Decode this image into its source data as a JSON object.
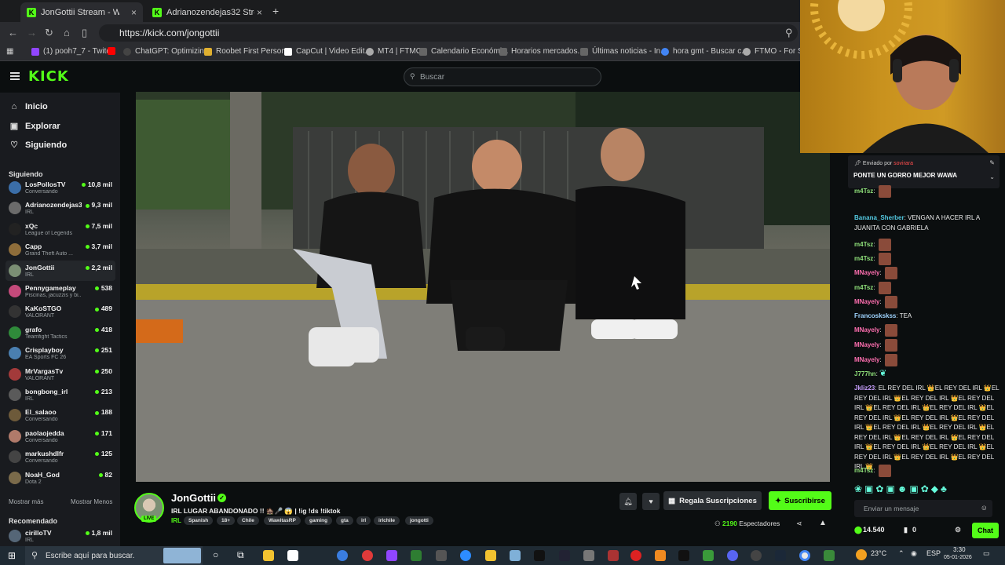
{
  "browser": {
    "tabs": [
      {
        "label": "JonGottii Stream - Watch L...",
        "active": true
      },
      {
        "label": "Adrianozendejas32 Stream - W...",
        "active": false
      }
    ],
    "new_tab": "+",
    "url": "https://kick.com/jongottii",
    "bookmarks": [
      "(1) pooh7_7 - Twitch",
      "ChatGPT: Optimizin...",
      "Roobet First Person...",
      "CapCut | Video Edit...",
      "MT4 | FTMO",
      "Calendario Económi...",
      "Horarios mercados...",
      "Últimas noticias - In...",
      "hora gmt - Buscar c...",
      "FTMO - For Serio"
    ]
  },
  "header": {
    "logo": "KICK",
    "search_placeholder": "Buscar"
  },
  "sidebar": {
    "nav": [
      "Inicio",
      "Explorar",
      "Siguiendo"
    ],
    "following_title": "Siguiendo",
    "following": [
      {
        "name": "LosPollosTV",
        "category": "Conversando",
        "viewers": "10,8 mil",
        "color": "#3b6ea8"
      },
      {
        "name": "Adrianozendejas32",
        "category": "IRL",
        "viewers": "9,3 mil",
        "color": "#6b6b6b"
      },
      {
        "name": "xQc",
        "category": "League of Legends",
        "viewers": "7,5 mil",
        "color": "#222222"
      },
      {
        "name": "Capp",
        "category": "Grand Theft Auto ...",
        "viewers": "3,7 mil",
        "color": "#8e6d3a"
      },
      {
        "name": "JonGottii",
        "category": "IRL",
        "viewers": "2,2 mil",
        "color": "#7b8f74"
      },
      {
        "name": "Pennygameplay",
        "category": "Piscinas, jacuzzis y bi...",
        "viewers": "538",
        "color": "#c44a7b"
      },
      {
        "name": "KaKoSTGO",
        "category": "VALORANT",
        "viewers": "489",
        "color": "#333333"
      },
      {
        "name": "grafo",
        "category": "Teamfight Tactics",
        "viewers": "418",
        "color": "#2f8a3a"
      },
      {
        "name": "Crisplayboy",
        "category": "EA Sports FC 26",
        "viewers": "251",
        "color": "#4a7fb0"
      },
      {
        "name": "MrVargasTv",
        "category": "VALORANT",
        "viewers": "250",
        "color": "#a33a3a"
      },
      {
        "name": "bongbong_irl",
        "category": "IRL",
        "viewers": "213",
        "color": "#5a5a5a"
      },
      {
        "name": "El_salaoo",
        "category": "Conversando",
        "viewers": "188",
        "color": "#6d5a3a"
      },
      {
        "name": "paolaojedda",
        "category": "Conversando",
        "viewers": "171",
        "color": "#b07a6a"
      },
      {
        "name": "markushdlfr",
        "category": "Conversando",
        "viewers": "125",
        "color": "#444444"
      },
      {
        "name": "NoaH_God",
        "category": "Dota 2",
        "viewers": "82",
        "color": "#7a6a4a"
      }
    ],
    "show_more": "Mostrar más",
    "show_less": "Mostrar Menos",
    "recommended_title": "Recomendado",
    "recommended": [
      {
        "name": "cirilloTV",
        "category": "IRL",
        "viewers": "1,8 mil",
        "color": "#556677"
      }
    ]
  },
  "stream": {
    "channel": "JonGottii",
    "live": "LIVE",
    "title": "IRL LUGAR ABANDONADO !! 🏚️🎤 😱 | !ig !ds !tiktok",
    "category": "IRL",
    "tags": [
      "Spanish",
      "18+",
      "Chile",
      "WawitasRP",
      "gaming",
      "gta",
      "irl",
      "irlchile",
      "jongotti"
    ],
    "gift_label": "Regala Suscripciones",
    "subscribe_label": "Suscribirse",
    "viewers": "2190",
    "viewers_label": "Espectadores"
  },
  "chat": {
    "pinned_by_label": "Enviado por",
    "pinned_by_user": "sovirara",
    "pinned_message": "PONTE UN GORRO MEJOR WAWA",
    "messages": [
      {
        "user": "m4Tsz",
        "text": "",
        "color": "#8fe07a",
        "emote": true
      },
      {
        "user": "Banana_Sherber",
        "text": "VENGAN A HACER IRL A JUANITA CON GABRIELA",
        "color": "#53c8e0",
        "emote": false
      },
      {
        "user": "m4Tsz",
        "text": "",
        "color": "#8fe07a",
        "emote": true
      },
      {
        "user": "m4Tsz",
        "text": "",
        "color": "#8fe07a",
        "emote": true
      },
      {
        "user": "MNayely",
        "text": "",
        "color": "#ff6fb0",
        "emote": true
      },
      {
        "user": "m4Tsz",
        "text": "",
        "color": "#8fe07a",
        "emote": true
      },
      {
        "user": "MNayely",
        "text": "",
        "color": "#ff6fb0",
        "emote": true
      },
      {
        "user": "Francoskskss",
        "text": "TEA",
        "color": "#9fd4ff",
        "emote": false
      },
      {
        "user": "MNayely",
        "text": "",
        "color": "#ff6fb0",
        "emote": true
      },
      {
        "user": "MNayely",
        "text": "",
        "color": "#ff6fb0",
        "emote": true
      },
      {
        "user": "MNayely",
        "text": "",
        "color": "#ff6fb0",
        "emote": true
      },
      {
        "user": "J777hn",
        "text": "",
        "color": "#8fe07a",
        "emote": false
      },
      {
        "user": "Jkliz23",
        "text": "EL REY DEL IRL 👑EL REY DEL IRL 👑EL REY DEL IRL 👑EL REY DEL IRL 👑EL REY DEL IRL 👑EL REY DEL IRL 👑EL REY DEL IRL 👑EL REY DEL IRL 👑EL REY DEL IRL 👑EL REY DEL IRL 👑EL REY DEL IRL 👑EL REY DEL IRL 👑EL REY DEL IRL 👑EL REY DEL IRL 👑EL REY DEL IRL 👑EL REY DEL IRL 👑EL REY DEL IRL 👑EL REY DEL IRL 👑EL REY DEL IRL 👑EL REY DEL IRL 👑",
        "color": "#c9a0ff",
        "emote": false
      },
      {
        "user": "m4Tsz",
        "text": "",
        "color": "#8fe07a",
        "emote": true
      }
    ],
    "input_placeholder": "Enviar un mensaje",
    "points": "14.540",
    "zero": "0",
    "chat_button": "Chat"
  },
  "taskbar": {
    "search_placeholder": "Escribe aquí para buscar.",
    "weather": "23°C",
    "lang": "ESP",
    "time": "3:30",
    "date": "05-01-2026"
  },
  "colors": {
    "accent": "#53fc18",
    "bg": "#0b0e0f",
    "sidebar": "#191b1f"
  }
}
